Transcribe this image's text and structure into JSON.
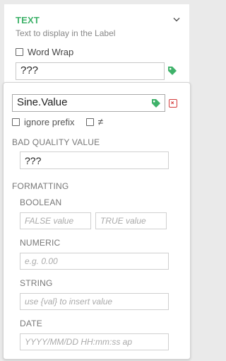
{
  "section": {
    "title": "TEXT",
    "description": "Text to display in the Label"
  },
  "word_wrap": {
    "label": "Word Wrap",
    "checked": false
  },
  "text_value": "???",
  "binding": {
    "tag_value": "Sine.Value",
    "ignore_prefix_label": "ignore prefix",
    "not_equal_symbol": "≠",
    "bad_quality": {
      "heading": "BAD QUALITY VALUE",
      "value": "???"
    },
    "formatting": {
      "heading": "FORMATTING",
      "boolean": {
        "heading": "BOOLEAN",
        "false_placeholder": "FALSE value",
        "true_placeholder": "TRUE value"
      },
      "numeric": {
        "heading": "NUMERIC",
        "placeholder": "e.g. 0.00"
      },
      "string": {
        "heading": "STRING",
        "placeholder": "use {val} to insert value"
      },
      "date": {
        "heading": "DATE",
        "placeholder": "YYYY/MM/DD HH:mm:ss ap"
      }
    }
  },
  "colors": {
    "accent_green": "#3fb26a",
    "remove_red": "#d43c3c"
  },
  "icons": [
    "chevron-down-icon",
    "tag-icon",
    "close-icon"
  ]
}
